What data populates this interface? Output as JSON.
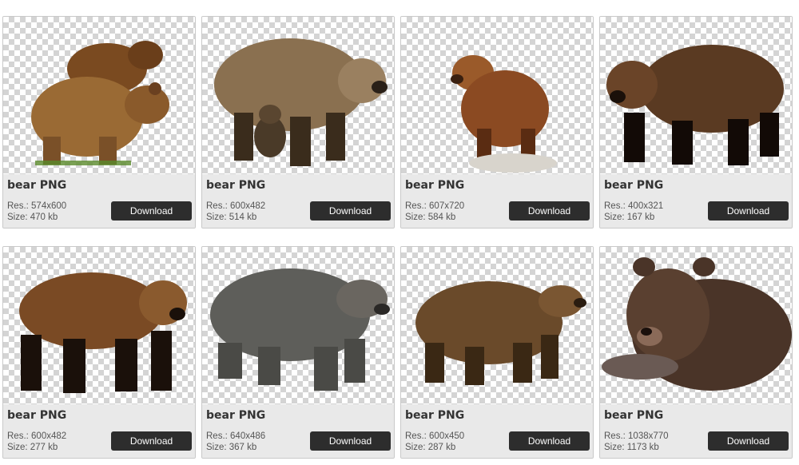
{
  "cards": [
    {
      "title": "bear PNG",
      "res": "Res.: 574x600",
      "size": "Size: 470 kb",
      "download_label": "Download",
      "image": "two-brown-bears",
      "fur": "#8a5a2b",
      "shade": "#5c3a18"
    },
    {
      "title": "bear PNG",
      "res": "Res.: 600x482",
      "size": "Size: 514 kb",
      "download_label": "Download",
      "image": "grizzly-with-cub",
      "fur": "#7a6248",
      "shade": "#4a3a28"
    },
    {
      "title": "bear PNG",
      "res": "Res.: 607x720",
      "size": "Size: 584 kb",
      "download_label": "Download",
      "image": "brown-bear-on-rock",
      "fur": "#8b4a22",
      "shade": "#5a2c12"
    },
    {
      "title": "bear PNG",
      "res": "Res.: 400x321",
      "size": "Size: 167 kb",
      "download_label": "Download",
      "image": "dark-brown-bear-walking",
      "fur": "#5a3a22",
      "shade": "#1c120a"
    },
    {
      "title": "bear PNG",
      "res": "Res.: 600x482",
      "size": "Size: 277 kb",
      "download_label": "Download",
      "image": "brown-bear-walking",
      "fur": "#7a4a24",
      "shade": "#1e120a"
    },
    {
      "title": "bear PNG",
      "res": "Res.: 640x486",
      "size": "Size: 367 kb",
      "download_label": "Download",
      "image": "grey-grizzly-bear",
      "fur": "#5e5e5a",
      "shade": "#3a3a38"
    },
    {
      "title": "bear PNG",
      "res": "Res.: 600x450",
      "size": "Size: 287 kb",
      "download_label": "Download",
      "image": "brown-bear-profile",
      "fur": "#6a4a2a",
      "shade": "#3a2814"
    },
    {
      "title": "bear PNG",
      "res": "Res.: 1038x770",
      "size": "Size: 1173 kb",
      "download_label": "Download",
      "image": "bear-lying-down",
      "fur": "#4a3428",
      "shade": "#2a1c14"
    }
  ]
}
